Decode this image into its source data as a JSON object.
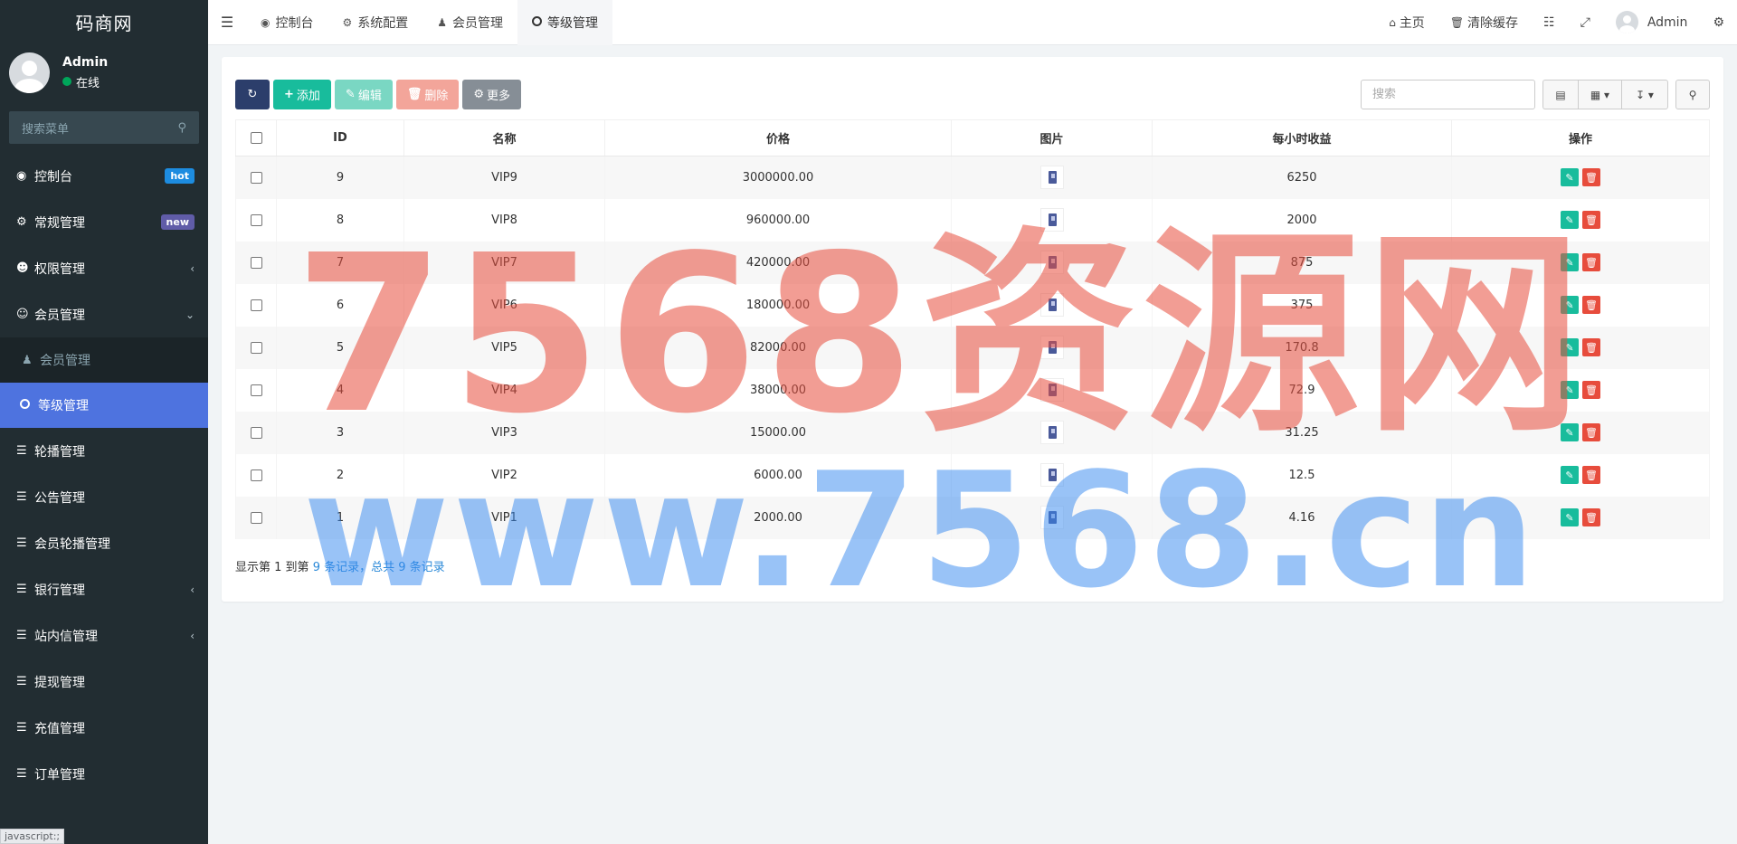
{
  "app": {
    "logo": "码商网"
  },
  "user": {
    "name": "Admin",
    "status": "在线"
  },
  "sidebar": {
    "search_placeholder": "搜索菜单",
    "items": [
      {
        "label": "控制台",
        "icon": "dashboard-icon",
        "badge": "hot"
      },
      {
        "label": "常规管理",
        "icon": "cogs-icon",
        "badge": "new"
      },
      {
        "label": "权限管理",
        "icon": "group-icon"
      },
      {
        "label": "会员管理",
        "icon": "user-circle-icon"
      },
      {
        "label": "轮播管理",
        "icon": "list-icon"
      },
      {
        "label": "公告管理",
        "icon": "list-icon"
      },
      {
        "label": "会员轮播管理",
        "icon": "list-icon"
      },
      {
        "label": "银行管理",
        "icon": "list-icon"
      },
      {
        "label": "站内信管理",
        "icon": "list-icon"
      },
      {
        "label": "提现管理",
        "icon": "list-icon"
      },
      {
        "label": "充值管理",
        "icon": "list-icon"
      },
      {
        "label": "订单管理",
        "icon": "list-icon"
      }
    ],
    "submenu": [
      {
        "label": "会员管理",
        "icon": "user-icon"
      },
      {
        "label": "等级管理",
        "icon": "circle-icon"
      }
    ]
  },
  "status_url": "javascript:;",
  "topbar": {
    "tabs": [
      {
        "label": "控制台",
        "icon": "dashboard-icon"
      },
      {
        "label": "系统配置",
        "icon": "cog-icon"
      },
      {
        "label": "会员管理",
        "icon": "user-icon"
      },
      {
        "label": "等级管理",
        "icon": "circle-icon"
      }
    ],
    "home": "主页",
    "clear_cache": "清除缓存",
    "username": "Admin"
  },
  "toolbar": {
    "add": "添加",
    "edit": "编辑",
    "delete": "删除",
    "more": "更多",
    "search_placeholder": "搜索"
  },
  "table": {
    "headers": [
      "ID",
      "名称",
      "价格",
      "图片",
      "每小时收益",
      "操作"
    ],
    "rows": [
      {
        "id": "9",
        "name": "VIP9",
        "price": "3000000.00",
        "earning": "6250"
      },
      {
        "id": "8",
        "name": "VIP8",
        "price": "960000.00",
        "earning": "2000"
      },
      {
        "id": "7",
        "name": "VIP7",
        "price": "420000.00",
        "earning": "875"
      },
      {
        "id": "6",
        "name": "VIP6",
        "price": "180000.00",
        "earning": "375"
      },
      {
        "id": "5",
        "name": "VIP5",
        "price": "82000.00",
        "earning": "170.8"
      },
      {
        "id": "4",
        "name": "VIP4",
        "price": "38000.00",
        "earning": "72.9"
      },
      {
        "id": "3",
        "name": "VIP3",
        "price": "15000.00",
        "earning": "31.25"
      },
      {
        "id": "2",
        "name": "VIP2",
        "price": "6000.00",
        "earning": "12.5"
      },
      {
        "id": "1",
        "name": "VIP1",
        "price": "2000.00",
        "earning": "4.16"
      }
    ]
  },
  "pager": {
    "p1": "显示第 ",
    "from": "1",
    "p2": " 到第 ",
    "to": "9",
    "p3": " 条记录，总共 ",
    "total": "9",
    "p4": " 条记录"
  },
  "watermark": {
    "line1": "7568资源网",
    "line2": "www.7568.cn"
  }
}
